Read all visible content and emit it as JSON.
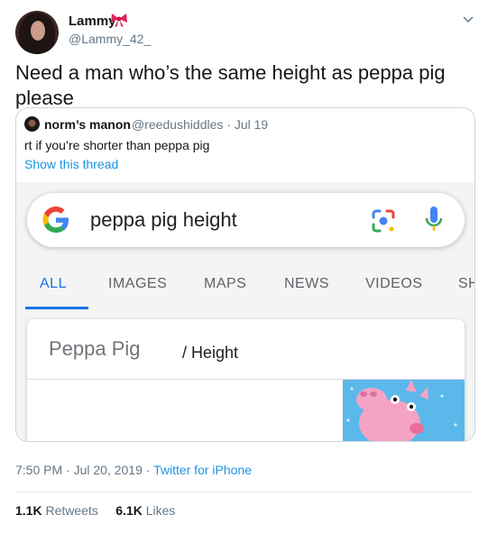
{
  "author": {
    "display_name": "Lammy",
    "handle": "@Lammy_42_"
  },
  "tweet": {
    "text": "Need a man who’s the same height as peppa pig please"
  },
  "quote": {
    "display_name": "norm’s manon",
    "handle_date": "@reedushiddles · Jul 19",
    "text": "rt if you’re shorter than peppa pig",
    "show_thread": "Show this thread",
    "screenshot": {
      "query": "peppa pig height",
      "tabs": [
        "ALL",
        "IMAGES",
        "MAPS",
        "NEWS",
        "VIDEOS",
        "SH"
      ],
      "active_tab": "ALL",
      "card_subject": "Peppa Pig",
      "card_attribute": "/ Height"
    }
  },
  "meta": {
    "time_date": "7:50 PM · Jul 20, 2019 · ",
    "source": "Twitter for iPhone"
  },
  "stats": {
    "retweets_count": "1.1K",
    "retweets_label": "Retweets",
    "likes_count": "6.1K",
    "likes_label": "Likes"
  },
  "colors": {
    "link_blue": "#1b95e0",
    "google_blue": "#1a73e8",
    "muted_gray": "#657786"
  }
}
